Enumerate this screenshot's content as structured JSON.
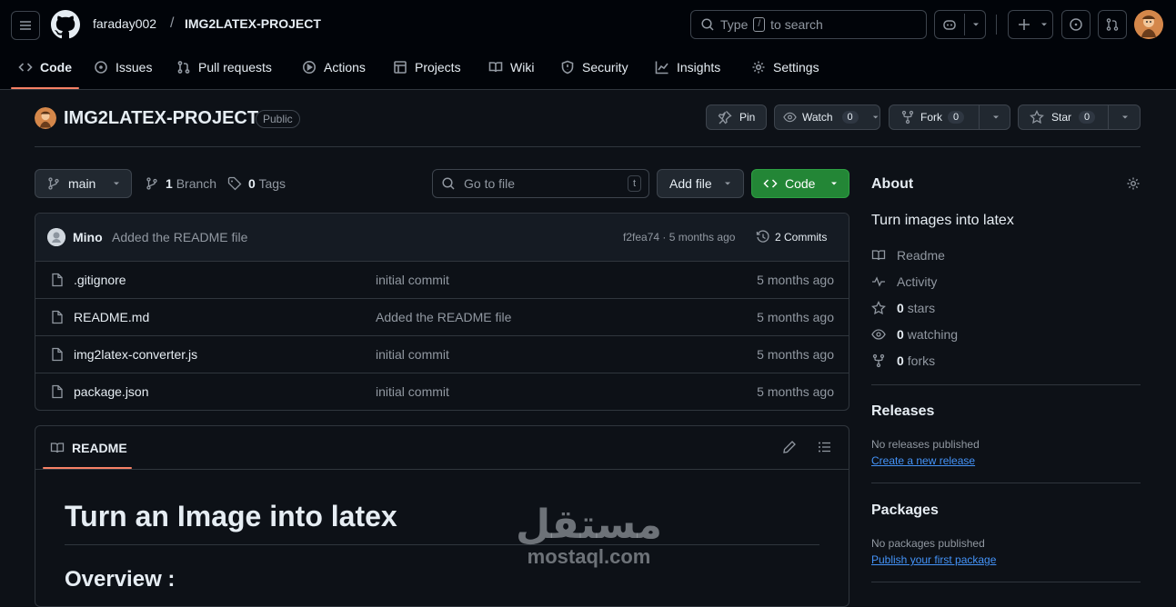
{
  "header": {
    "owner": "faraday002",
    "slash": "/",
    "repo": "IMG2LATEX-PROJECT",
    "search_prefix": "Type",
    "search_key": "/",
    "search_suffix": "to search"
  },
  "tabs": [
    {
      "label": "Code",
      "icon": "code-icon"
    },
    {
      "label": "Issues",
      "icon": "issue-icon"
    },
    {
      "label": "Pull requests",
      "icon": "pull-request-icon"
    },
    {
      "label": "Actions",
      "icon": "play-icon"
    },
    {
      "label": "Projects",
      "icon": "table-icon"
    },
    {
      "label": "Wiki",
      "icon": "book-icon"
    },
    {
      "label": "Security",
      "icon": "shield-icon"
    },
    {
      "label": "Insights",
      "icon": "graph-icon"
    },
    {
      "label": "Settings",
      "icon": "gear-icon"
    }
  ],
  "repo_header": {
    "name": "IMG2LATEX-PROJECT",
    "visibility": "Public",
    "pin_label": "Pin",
    "watch_label": "Watch",
    "watch_count": "0",
    "fork_label": "Fork",
    "fork_count": "0",
    "star_label": "Star",
    "star_count": "0"
  },
  "toolbar": {
    "branch": "main",
    "branch_count": "1",
    "branch_label": "Branch",
    "tag_count": "0",
    "tag_label": "Tags",
    "goto_placeholder": "Go to file",
    "goto_key": "t",
    "add_file_label": "Add file",
    "code_label": "Code"
  },
  "commit": {
    "author": "Mino",
    "message": "Added the README file",
    "meta": "f2fea74 · 5 months ago",
    "commits_label": "2 Commits"
  },
  "files": [
    {
      "name": ".gitignore",
      "message": "initial commit",
      "date": "5 months ago"
    },
    {
      "name": "README.md",
      "message": "Added the README file",
      "date": "5 months ago"
    },
    {
      "name": "img2latex-converter.js",
      "message": "initial commit",
      "date": "5 months ago"
    },
    {
      "name": "package.json",
      "message": "initial commit",
      "date": "5 months ago"
    }
  ],
  "readme": {
    "tab_label": "README",
    "h1": "Turn an Image into latex",
    "h2": "Overview :"
  },
  "about": {
    "title": "About",
    "description": "Turn images into latex",
    "readme": "Readme",
    "activity": "Activity",
    "stars_count": "0",
    "stars_label": "stars",
    "watching_count": "0",
    "watching_label": "watching",
    "forks_count": "0",
    "forks_label": "forks"
  },
  "releases": {
    "title": "Releases",
    "empty": "No releases published",
    "link": "Create a new release"
  },
  "packages": {
    "title": "Packages",
    "empty": "No packages published",
    "link": "Publish your first package"
  },
  "watermark": {
    "arabic": "مستقل",
    "latin": "mostaql.com"
  },
  "colors": {
    "bg": "#0d1117",
    "header_bg": "#010409",
    "accent_green": "#238636",
    "link": "#4493f8",
    "active_tab_underline": "#f78166"
  }
}
